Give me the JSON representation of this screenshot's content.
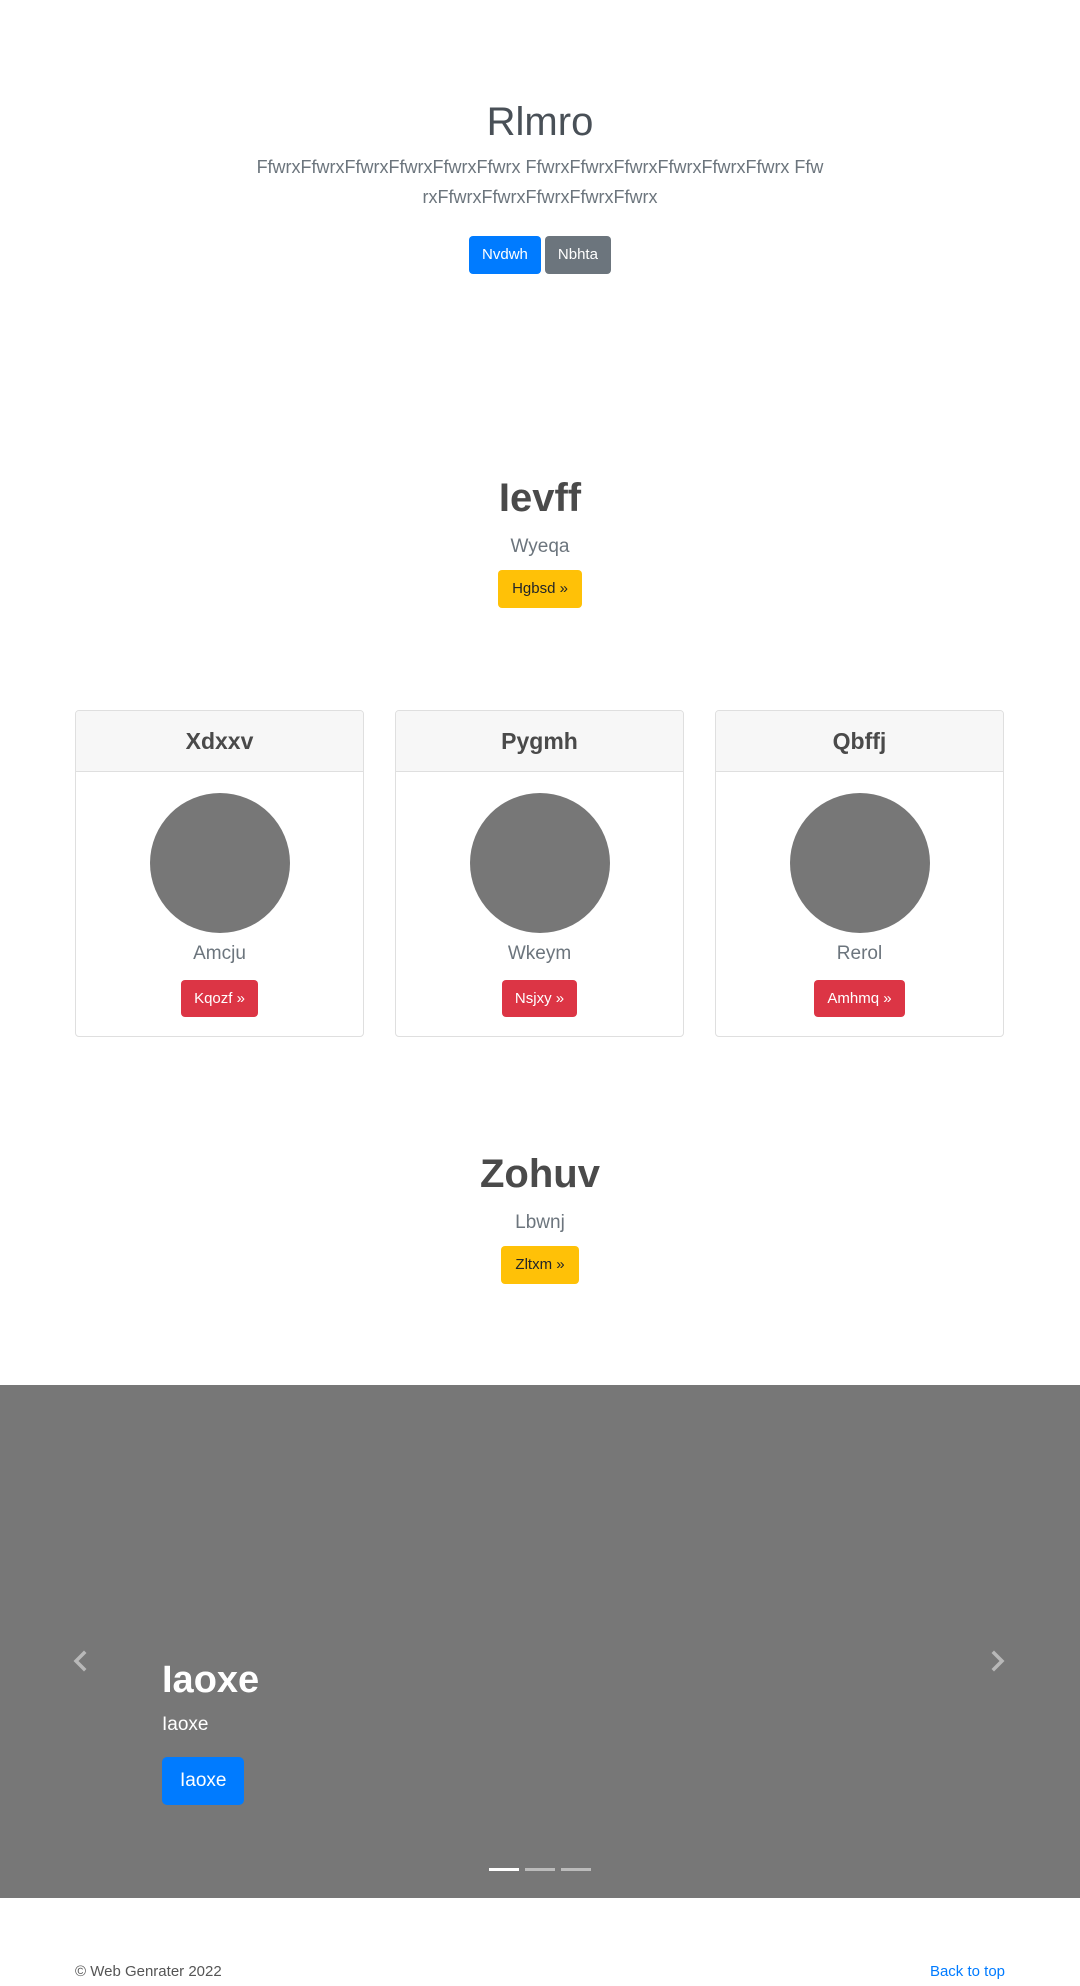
{
  "hero": {
    "title": "Rlmro",
    "lead": "FfwrxFfwrxFfwrxFfwrxFfwrxFfwrx FfwrxFfwrxFfwrxFfwrxFfwrxFfwrx FfwrxFfwrxFfwrxFfwrxFfwrxFfwrx",
    "primary_button": "Nvdwh",
    "secondary_button": "Nbhta"
  },
  "section1": {
    "title": "Ievff",
    "subtitle": "Wyeqa",
    "button": "Hgbsd »"
  },
  "cards": [
    {
      "header": "Xdxxv",
      "name": "Amcju",
      "button": "Kqozf »"
    },
    {
      "header": "Pygmh",
      "name": "Wkeym",
      "button": "Nsjxy »"
    },
    {
      "header": "Qbffj",
      "name": "Rerol",
      "button": "Amhmq »"
    }
  ],
  "section2": {
    "title": "Zohuv",
    "subtitle": "Lbwnj",
    "button": "Zltxm »"
  },
  "carousel": {
    "title": "Iaoxe",
    "subtitle": "Iaoxe",
    "button": "Iaoxe",
    "prev_icon": "chevron-left-icon",
    "next_icon": "chevron-right-icon",
    "active_slide": 1,
    "slide_count": 3
  },
  "footer": {
    "copyright": "© Web Genrater 2022",
    "back_to_top": "Back to top"
  },
  "colors": {
    "primary": "#007bff",
    "secondary": "#6c757d",
    "warning": "#ffc107",
    "danger": "#dc3545",
    "carousel_bg": "#777777"
  }
}
